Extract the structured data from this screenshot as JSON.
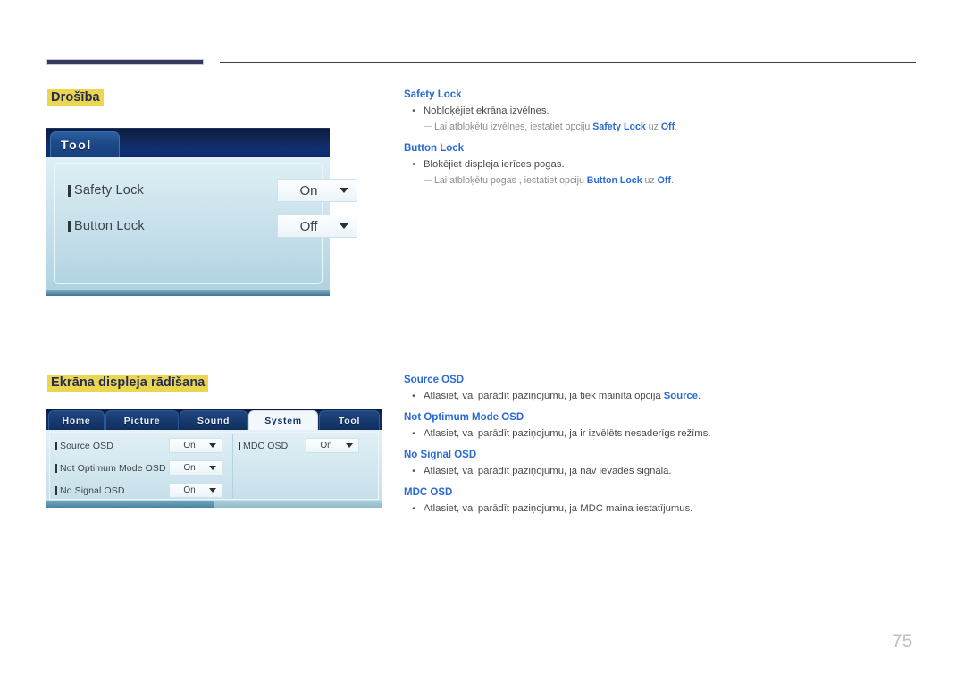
{
  "page": {
    "number": "75"
  },
  "sections": [
    {
      "heading": "Drošība",
      "osd": {
        "type": "tool-panel",
        "tab_label": "Tool",
        "rows": [
          {
            "label": "Safety Lock",
            "value": "On"
          },
          {
            "label": "Button Lock",
            "value": "Off"
          }
        ]
      },
      "entries": [
        {
          "title": "Safety Lock",
          "bullets": [
            "Nobloķējiet ekrāna izvēlnes."
          ],
          "notes": [
            {
              "pre": "Lai atbloķētu izvēlnes, iestatiet opciju ",
              "b1": "Safety Lock",
              "mid": " uz ",
              "b2": "Off",
              "post": "."
            }
          ]
        },
        {
          "title": "Button Lock",
          "bullets": [
            "Bloķējiet displeja ierīces pogas."
          ],
          "notes": [
            {
              "pre": "Lai atbloķētu pogas , iestatiet opciju ",
              "b1": "Button Lock",
              "mid": " uz ",
              "b2": "Off",
              "post": "."
            }
          ]
        }
      ]
    },
    {
      "heading": "Ekrāna displeja rādīšana",
      "osd": {
        "type": "system-panel",
        "tabs": [
          {
            "label": "Home",
            "active": false
          },
          {
            "label": "Picture",
            "active": false
          },
          {
            "label": "Sound",
            "active": false
          },
          {
            "label": "System",
            "active": true
          },
          {
            "label": "Tool",
            "active": false
          }
        ],
        "rows_left": [
          {
            "label": "Source OSD",
            "value": "On"
          },
          {
            "label": "Not Optimum Mode OSD",
            "value": "On"
          },
          {
            "label": "No Signal OSD",
            "value": "On"
          }
        ],
        "rows_right": [
          {
            "label": "MDC OSD",
            "value": "On"
          }
        ]
      },
      "entries": [
        {
          "title": "Source OSD",
          "bullet_pre": "Atlasiet, vai parādīt paziņojumu, ja tiek mainīta opcija ",
          "bullet_bold": "Source",
          "bullet_post": "."
        },
        {
          "title": "Not Optimum Mode OSD",
          "bullet_pre": "Atlasiet, vai parādīt paziņojumu, ja ir izvēlēts nesaderīgs režīms.",
          "bullet_bold": "",
          "bullet_post": ""
        },
        {
          "title": "No Signal OSD",
          "bullet_pre": "Atlasiet, vai parādīt paziņojumu, ja nav ievades signāla.",
          "bullet_bold": "",
          "bullet_post": ""
        },
        {
          "title": "MDC OSD",
          "bullet_pre": "Atlasiet, vai parādīt paziņojumu, ja MDC maina iestatījumus.",
          "bullet_bold": "",
          "bullet_post": ""
        }
      ]
    }
  ],
  "glyphs": {
    "bullet": "•",
    "dash": "—"
  },
  "colors": {
    "highlight": "#ecd64f",
    "heading_text": "#252c52",
    "blue": "#2a6ad4",
    "body_text": "#4a4a4a",
    "note_text": "#8d8d8d",
    "rule": "#343b5e",
    "page_number": "#c0c0c0"
  }
}
